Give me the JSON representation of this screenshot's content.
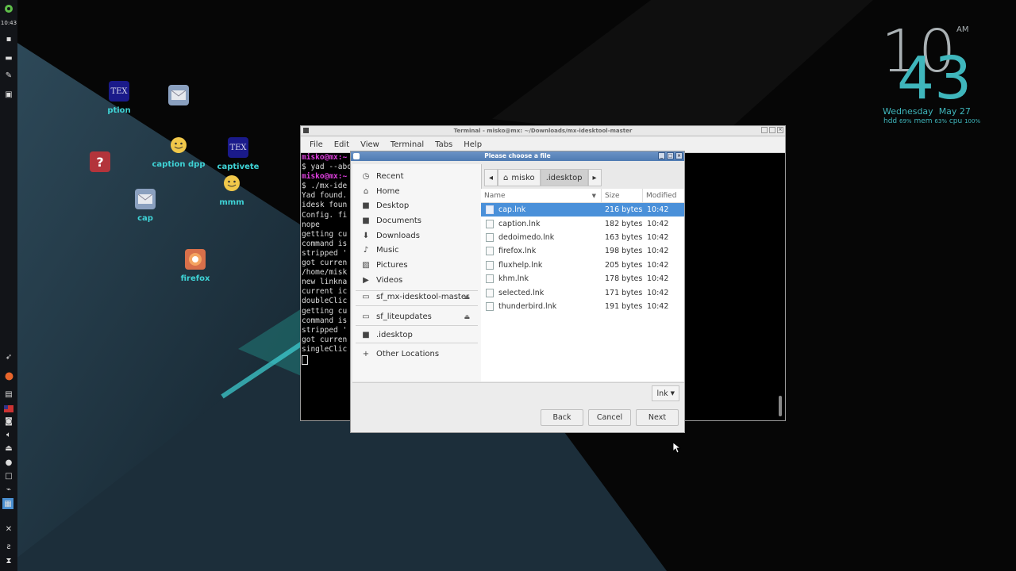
{
  "panel": {
    "time": "10:43"
  },
  "desktop_icons": [
    {
      "label": "ption",
      "icon": "tex-icon"
    },
    {
      "label": "caption dpp",
      "icon": "emoji-icon"
    },
    {
      "label": "captivete",
      "icon": "tex-icon"
    },
    {
      "label": "mmm",
      "icon": "emoji-icon"
    },
    {
      "label": "cap",
      "icon": "mail-icon"
    },
    {
      "label": "firefox",
      "icon": "firefox-icon"
    },
    {
      "label": "",
      "icon": "help-icon"
    },
    {
      "label": "",
      "icon": "mail-icon"
    }
  ],
  "conky": {
    "hour": "10",
    "minute": "43",
    "ampm": "AM",
    "day": "Wednesday",
    "date": "May 27",
    "hdd_label": "hdd",
    "hdd": "69%",
    "mem_label": "mem",
    "mem": "63%",
    "cpu_label": "cpu",
    "cpu": "100%"
  },
  "terminal": {
    "title": "Terminal - misko@mx: ~/Downloads/mx-idesktool-master",
    "menu": [
      "File",
      "Edit",
      "View",
      "Terminal",
      "Tabs",
      "Help"
    ],
    "lines": [
      {
        "prompt": "misko@mx:~",
        "text": ""
      },
      {
        "prompt": "",
        "text": "$ yad --abo"
      },
      {
        "prompt": "misko@mx:~",
        "text": ""
      },
      {
        "prompt": "",
        "text": "$ ./mx-ide"
      },
      {
        "prompt": "",
        "text": "Yad found."
      },
      {
        "prompt": "",
        "text": "idesk foun"
      },
      {
        "prompt": "",
        "text": "Config. fi"
      },
      {
        "prompt": "",
        "text": "nope"
      },
      {
        "prompt": "",
        "text": "getting cu"
      },
      {
        "prompt": "",
        "text": "command is"
      },
      {
        "prompt": "",
        "text": "stripped '"
      },
      {
        "prompt": "",
        "text": "got curren"
      },
      {
        "prompt": "",
        "text": "/home/misk"
      },
      {
        "prompt": "",
        "text": "new linkna"
      },
      {
        "prompt": "",
        "text": "current ic"
      },
      {
        "prompt": "",
        "text": "doubleClic"
      },
      {
        "prompt": "",
        "text": "getting cu"
      },
      {
        "prompt": "",
        "text": "command is"
      },
      {
        "prompt": "",
        "text": "stripped '"
      },
      {
        "prompt": "",
        "text": "got curren"
      },
      {
        "prompt": "",
        "text": "singleClic"
      }
    ]
  },
  "dialog": {
    "title": "Please choose a file",
    "places": [
      {
        "label": "Recent",
        "icon": "clock-icon"
      },
      {
        "label": "Home",
        "icon": "home-icon"
      },
      {
        "label": "Desktop",
        "icon": "folder-icon"
      },
      {
        "label": "Documents",
        "icon": "folder-icon"
      },
      {
        "label": "Downloads",
        "icon": "download-icon"
      },
      {
        "label": "Music",
        "icon": "music-icon"
      },
      {
        "label": "Pictures",
        "icon": "picture-icon"
      },
      {
        "label": "Videos",
        "icon": "video-icon"
      }
    ],
    "devices": [
      {
        "label": "sf_mx-idesktool-master",
        "icon": "drive-icon"
      },
      {
        "label": "sf_liteupdates",
        "icon": "drive-icon"
      }
    ],
    "bookmarks": [
      {
        "label": ".idesktop",
        "icon": "folder-icon"
      }
    ],
    "other_locations": "Other Locations",
    "path": [
      "misko",
      ".idesktop"
    ],
    "columns": {
      "name": "Name",
      "size": "Size",
      "modified": "Modified"
    },
    "files": [
      {
        "name": "cap.lnk",
        "size": "216 bytes",
        "modified": "10:42",
        "selected": true
      },
      {
        "name": "caption.lnk",
        "size": "182 bytes",
        "modified": "10:42"
      },
      {
        "name": "dedoimedo.lnk",
        "size": "163 bytes",
        "modified": "10:42"
      },
      {
        "name": "firefox.lnk",
        "size": "198 bytes",
        "modified": "10:42"
      },
      {
        "name": "fluxhelp.lnk",
        "size": "205 bytes",
        "modified": "10:42"
      },
      {
        "name": "khm.lnk",
        "size": "178 bytes",
        "modified": "10:42"
      },
      {
        "name": "selected.lnk",
        "size": "171 bytes",
        "modified": "10:42"
      },
      {
        "name": "thunderbird.lnk",
        "size": "191 bytes",
        "modified": "10:42"
      }
    ],
    "filter": "lnk",
    "buttons": {
      "back": "Back",
      "cancel": "Cancel",
      "next": "Next"
    }
  },
  "colors": {
    "accent_teal": "#3fd3d6",
    "selection": "#4a90d9",
    "prompt": "#e040e0"
  }
}
